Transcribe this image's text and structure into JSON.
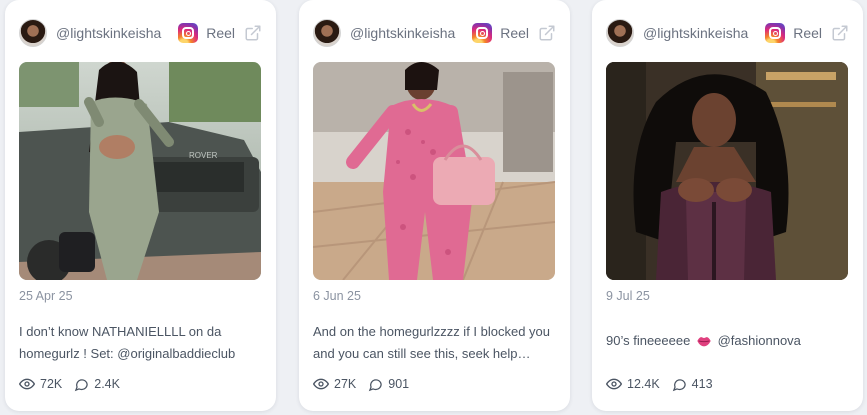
{
  "cards": [
    {
      "handle": "@lightskinkeisha",
      "type_label": "Reel",
      "date": "25 Apr 25",
      "caption": "I don’t know NATHANIELLLL on da homegurlz ! Set: @originalbaddieclub",
      "views": "72K",
      "comments": "2.4K"
    },
    {
      "handle": "@lightskinkeisha",
      "type_label": "Reel",
      "date": "6 Jun 25",
      "caption": "And on the homegurlzzzz if I blocked you and you can still see this, seek help…",
      "views": "27K",
      "comments": "901"
    },
    {
      "handle": "@lightskinkeisha",
      "type_label": "Reel",
      "date": "9 Jul 25",
      "caption_before": "90’s fineeeeee",
      "caption_emoji": "lips-emoji",
      "caption_after": "@fashionnova",
      "views": "12.4K",
      "comments": "413"
    }
  ],
  "icons": {
    "platform": "instagram-icon",
    "open": "external-link-icon",
    "views": "eye-icon",
    "comments": "comment-icon"
  },
  "colors": {
    "instagram_gradient": [
      "#feda75",
      "#f58529",
      "#dd2a7b",
      "#8134af",
      "#515bd4"
    ],
    "text_muted": "#8b93a1",
    "text": "#4b5563"
  }
}
